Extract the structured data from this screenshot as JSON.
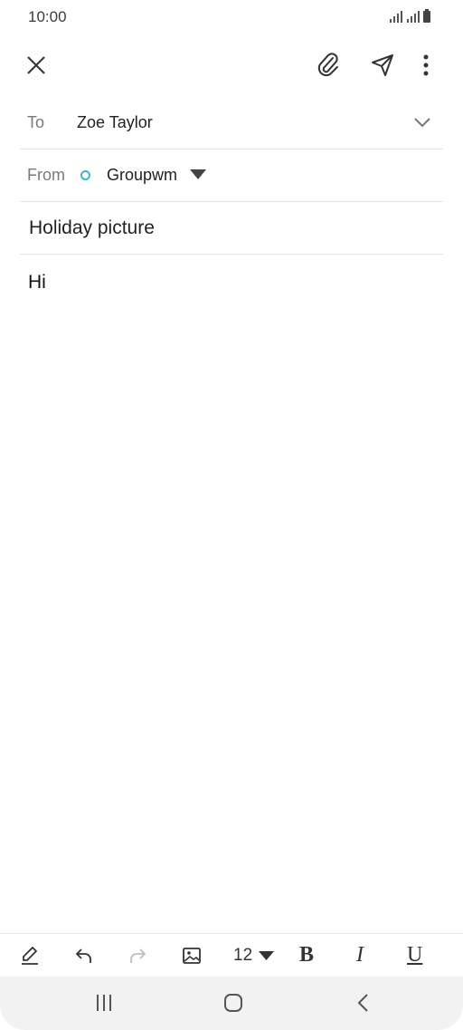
{
  "status_bar": {
    "time": "10:00",
    "icons": [
      "signal-icon",
      "signal-icon",
      "battery-icon"
    ]
  },
  "toolbar": {
    "close_icon": "close-icon",
    "attach_icon": "paperclip-icon",
    "send_icon": "send-icon",
    "more_icon": "more-vert-icon"
  },
  "compose": {
    "to_label": "To",
    "to_value": "Zoe Taylor",
    "from_label": "From",
    "from_value": "Groupwm",
    "subject": "Holiday picture",
    "body": "Hi"
  },
  "format_bar": {
    "font_size": "12",
    "bold_label": "B",
    "italic_label": "I",
    "underline_label": "U"
  },
  "colors": {
    "account_dot": "#35b7d3",
    "divider": "#e3e3e3",
    "nav_bg": "#f2f2f2"
  }
}
